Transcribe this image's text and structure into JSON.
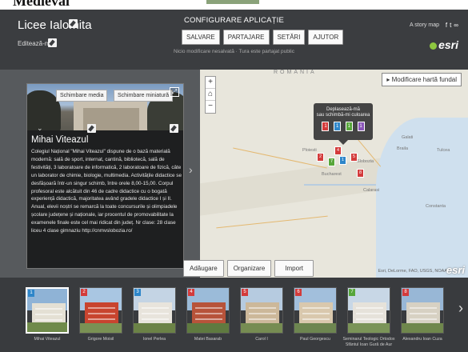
{
  "page_top": {
    "heading": "Medieval"
  },
  "header": {
    "title": "Licee Ialomita",
    "subtitle": "Editează-mă",
    "config_title": "CONFIGURARE APLICAȚIE",
    "buttons": [
      "SALVARE",
      "PARTAJARE",
      "SETĂRI",
      "AJUTOR"
    ],
    "status": "Nicio modificare nesalvată · Tura este partajat public",
    "story_label": "A story map",
    "brand": "esri"
  },
  "card": {
    "change_media": "Schimbare media",
    "change_thumb": "Schimbare miniatură",
    "title": "Mihai Viteazul",
    "text": "Colegiul Național \"Mihai Viteazul\" dispune de o bază materială modernă: sală de sport, internat, cantină, bibliotecă, sală de festivități, 3 laboratoare de informatică, 2 laboratoare de fizică, câte un laborator de chimie, biologie, multimedia. Activitățile didactice se desfășoară într-un singur schimb, între orele 8,00-15,00. Corpul profesoral este alcătuit din 46 de cadre didactice cu o bogată experiență didactică, majoritatea având gradele didactice I și II. Anual, elevii noștri se remarcă la toate concursurile și olimpiadele școlare județene și naționale, iar procentul de promovabilitate la examenele finale este cel mai ridicat din județ. Nr clase: 28 clase liceu 4 clase gimnaziu http://cnmvslobozia.ro/"
  },
  "map": {
    "header_label": "ROMANIA",
    "modify_btn": "▸ Modificare hartă fundal",
    "tooltip": [
      "Deplasează-mă",
      "sau schimbă-mi culoarea"
    ],
    "tooltip_colors": [
      "#d33b3b",
      "#2e86c9",
      "#57a63a",
      "#8a55b8"
    ],
    "attribution": "Esri, DeLorme, FAO, USGS, NOAA",
    "esri_mark": "esri",
    "tools": [
      "Adăugare",
      "Organizare",
      "Import"
    ],
    "places": [
      "Bucharest",
      "Galati",
      "Braila",
      "Tulcea",
      "Constanta",
      "Ploiesti",
      "Slobozia",
      "Calarasi"
    ]
  },
  "carousel": [
    {
      "num": "1",
      "color": "#2e86c9",
      "caption": "Mihai Viteazul"
    },
    {
      "num": "2",
      "color": "#d33b3b",
      "caption": "Grigore Moisil"
    },
    {
      "num": "3",
      "color": "#2e86c9",
      "caption": "Ionel Perlea"
    },
    {
      "num": "4",
      "color": "#d33b3b",
      "caption": "Matei Basarab"
    },
    {
      "num": "5",
      "color": "#d33b3b",
      "caption": "Carol I"
    },
    {
      "num": "6",
      "color": "#d33b3b",
      "caption": "Paul Georgescu"
    },
    {
      "num": "7",
      "color": "#57a63a",
      "caption": "Seminarul Teologic Ortodox Sfântul Ioan Gură de Aur"
    },
    {
      "num": "8",
      "color": "#d33b3b",
      "caption": "Alexandru Ioan Cuza"
    }
  ]
}
